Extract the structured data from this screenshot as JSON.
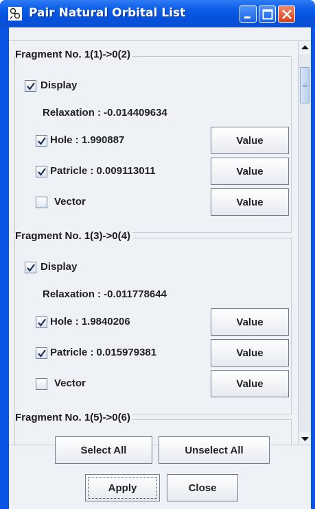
{
  "window": {
    "title": "Pair Natural Orbital List",
    "icon": "molecule-icon",
    "controls": {
      "minimize": "minimize-icon",
      "maximize": "maximize-icon",
      "close": "close-icon"
    },
    "colors": {
      "titlebar": "#0651dc",
      "background": "#eef2f7",
      "close": "#d8401c"
    }
  },
  "fragments": [
    {
      "title": "Fragment No. 1(1)->0(2)",
      "display_label": "Display",
      "display_checked": true,
      "relaxation": "Relaxation : -0.014409634",
      "hole_label": "Hole : 1.990887",
      "hole_checked": true,
      "particle_label": "Patricle : 0.009113011",
      "particle_checked": true,
      "vector_label": "Vector",
      "vector_checked": false,
      "value_label": "Value"
    },
    {
      "title": "Fragment No. 1(3)->0(4)",
      "display_label": "Display",
      "display_checked": true,
      "relaxation": "Relaxation : -0.011778644",
      "hole_label": "Hole : 1.9840206",
      "hole_checked": true,
      "particle_label": "Patricle : 0.015979381",
      "particle_checked": true,
      "vector_label": "Vector",
      "vector_checked": false,
      "value_label": "Value"
    },
    {
      "title": "Fragment No. 1(5)->0(6)"
    }
  ],
  "buttons": {
    "select_all": "Select All",
    "unselect_all": "Unselect All",
    "apply": "Apply",
    "close": "Close"
  }
}
